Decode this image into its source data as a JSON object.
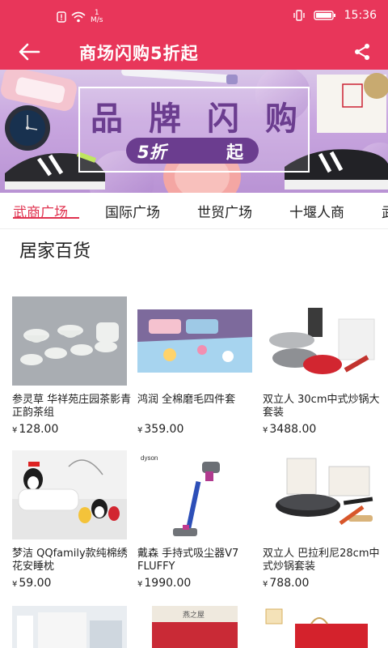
{
  "status_bar": {
    "net_speed_value": "1",
    "net_speed_unit": "M/s",
    "time": "15:36"
  },
  "topbar": {
    "title": "商场闪购5折起"
  },
  "banner": {
    "title_chars": [
      "品",
      "牌",
      "闪",
      "购"
    ],
    "discount": "5折",
    "suffix": "起"
  },
  "tabs": [
    {
      "label": "武商广场",
      "active": true
    },
    {
      "label": "国际广场",
      "active": false
    },
    {
      "label": "世贸广场",
      "active": false
    },
    {
      "label": "十堰人商",
      "active": false
    },
    {
      "label": "武",
      "active": false
    }
  ],
  "section_title": "居家百货",
  "currency_symbol": "¥",
  "products": [
    {
      "name": "参灵草 华祥苑庄园茶影青正韵茶组",
      "price": "128.00",
      "image": "tea-set"
    },
    {
      "name": "鸿润 全棉磨毛四件套",
      "price": "359.00",
      "image": "bedding-set"
    },
    {
      "name": "双立人 30cm中式炒锅大套装",
      "price": "3488.00",
      "image": "cookware-set"
    },
    {
      "name": "梦洁 QQfamily款纯棉绣花安睡枕",
      "price": "59.00",
      "image": "pillow"
    },
    {
      "name": "戴森 手持式吸尘器V7 FLUFFY",
      "price": "1990.00",
      "image": "vacuum"
    },
    {
      "name": "双立人 巴拉利尼28cm中式炒锅套装",
      "price": "788.00",
      "image": "wok-set"
    }
  ],
  "partial_row_images": [
    "bedroom",
    "gift-box",
    "gift-bag"
  ],
  "partial_row_texts": {
    "dyson_brand": "dyson",
    "gift_box_label": "燕之屋"
  }
}
